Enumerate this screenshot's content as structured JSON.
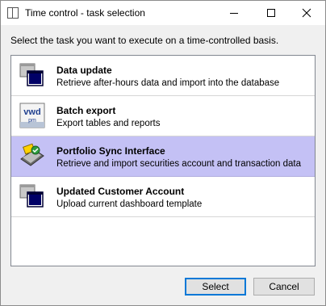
{
  "window": {
    "title": "Time control - task selection"
  },
  "prompt": "Select the task you want to execute on a time-controlled basis.",
  "tasks": [
    {
      "title": "Data update",
      "description": "Retrieve after-hours data and import into the database",
      "icon": "window-stack-icon",
      "selected": false
    },
    {
      "title": "Batch export",
      "description": "Export tables and reports",
      "icon": "vwd-pm-icon",
      "vwd_label": "vwd",
      "pm_label": "pm",
      "selected": false
    },
    {
      "title": "Portfolio Sync Interface",
      "description": "Retrieve and import securities account and transaction data",
      "icon": "sync-interface-icon",
      "selected": true
    },
    {
      "title": "Updated Customer Account",
      "description": "Upload current dashboard template",
      "icon": "window-stack-icon",
      "selected": false
    }
  ],
  "buttons": {
    "select_label": "Select",
    "cancel_label": "Cancel"
  },
  "colors": {
    "selected_row": "#c4c1f5",
    "accent": "#0078d7"
  }
}
